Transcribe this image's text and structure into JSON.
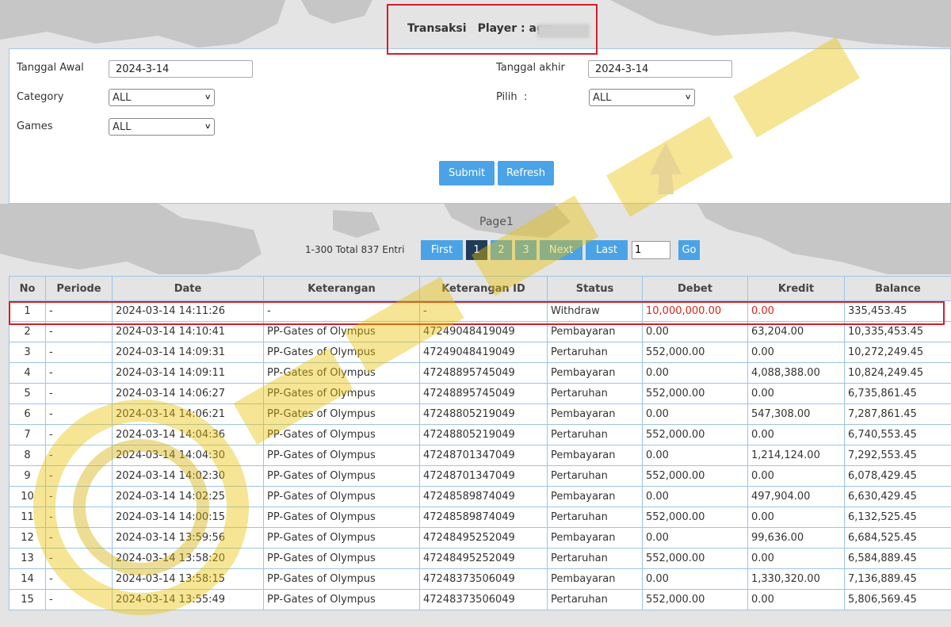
{
  "header": {
    "title": "Transaksi",
    "player_label": "Player : agu"
  },
  "filters": {
    "tanggal_awal_label": "Tanggal Awal",
    "tanggal_awal_value": "2024-3-14",
    "tanggal_akhir_label": "Tanggal akhir",
    "tanggal_akhir_value": "2024-3-14",
    "category_label": "Category",
    "category_value": "ALL",
    "pilih_label": "Pilih  :",
    "pilih_value": "ALL",
    "games_label": "Games",
    "games_value": "ALL",
    "submit_label": "Submit",
    "refresh_label": "Refresh"
  },
  "pagination": {
    "page_title": "Page1",
    "total_text": "1-300 Total 837 Entri",
    "first": "First",
    "p1": "1",
    "p2": "2",
    "p3": "3",
    "next": "Next",
    "last": "Last",
    "page_input_value": "1",
    "go": "Go"
  },
  "table": {
    "headers": [
      "No",
      "Periode",
      "Date",
      "Keterangan",
      "Keterangan ID",
      "Status",
      "Debet",
      "Kredit",
      "Balance"
    ],
    "rows": [
      [
        "1",
        "-",
        "2024-03-14 14:11:26",
        "-",
        "-",
        "Withdraw",
        "10,000,000.00",
        "0.00",
        "335,453.45"
      ],
      [
        "2",
        "-",
        "2024-03-14 14:10:41",
        "PP-Gates of Olympus",
        "47249048419049",
        "Pembayaran",
        "0.00",
        "63,204.00",
        "10,335,453.45"
      ],
      [
        "3",
        "-",
        "2024-03-14 14:09:31",
        "PP-Gates of Olympus",
        "47249048419049",
        "Pertaruhan",
        "552,000.00",
        "0.00",
        "10,272,249.45"
      ],
      [
        "4",
        "-",
        "2024-03-14 14:09:11",
        "PP-Gates of Olympus",
        "47248895745049",
        "Pembayaran",
        "0.00",
        "4,088,388.00",
        "10,824,249.45"
      ],
      [
        "5",
        "-",
        "2024-03-14 14:06:27",
        "PP-Gates of Olympus",
        "47248895745049",
        "Pertaruhan",
        "552,000.00",
        "0.00",
        "6,735,861.45"
      ],
      [
        "6",
        "-",
        "2024-03-14 14:06:21",
        "PP-Gates of Olympus",
        "47248805219049",
        "Pembayaran",
        "0.00",
        "547,308.00",
        "7,287,861.45"
      ],
      [
        "7",
        "-",
        "2024-03-14 14:04:36",
        "PP-Gates of Olympus",
        "47248805219049",
        "Pertaruhan",
        "552,000.00",
        "0.00",
        "6,740,553.45"
      ],
      [
        "8",
        "-",
        "2024-03-14 14:04:30",
        "PP-Gates of Olympus",
        "47248701347049",
        "Pembayaran",
        "0.00",
        "1,214,124.00",
        "7,292,553.45"
      ],
      [
        "9",
        "-",
        "2024-03-14 14:02:30",
        "PP-Gates of Olympus",
        "47248701347049",
        "Pertaruhan",
        "552,000.00",
        "0.00",
        "6,078,429.45"
      ],
      [
        "10",
        "-",
        "2024-03-14 14:02:25",
        "PP-Gates of Olympus",
        "47248589874049",
        "Pembayaran",
        "0.00",
        "497,904.00",
        "6,630,429.45"
      ],
      [
        "11",
        "-",
        "2024-03-14 14:00:15",
        "PP-Gates of Olympus",
        "47248589874049",
        "Pertaruhan",
        "552,000.00",
        "0.00",
        "6,132,525.45"
      ],
      [
        "12",
        "-",
        "2024-03-14 13:59:56",
        "PP-Gates of Olympus",
        "47248495252049",
        "Pembayaran",
        "0.00",
        "99,636.00",
        "6,684,525.45"
      ],
      [
        "13",
        "-",
        "2024-03-14 13:58:20",
        "PP-Gates of Olympus",
        "47248495252049",
        "Pertaruhan",
        "552,000.00",
        "0.00",
        "6,584,889.45"
      ],
      [
        "14",
        "-",
        "2024-03-14 13:58:15",
        "PP-Gates of Olympus",
        "47248373506049",
        "Pembayaran",
        "0.00",
        "1,330,320.00",
        "7,136,889.45"
      ],
      [
        "15",
        "-",
        "2024-03-14 13:55:49",
        "PP-Gates of Olympus",
        "47248373506049",
        "Pertaruhan",
        "552,000.00",
        "0.00",
        "5,806,569.45"
      ]
    ]
  },
  "colors": {
    "accent": "#4aa3e6",
    "active_page": "#1f3b57",
    "highlight_border": "#d0202a",
    "withdraw_text": "#d9261c",
    "table_border": "#9cc3e6"
  },
  "icons": {
    "select_arrow": "chevron-down-icon",
    "watermark": "logo-watermark"
  }
}
